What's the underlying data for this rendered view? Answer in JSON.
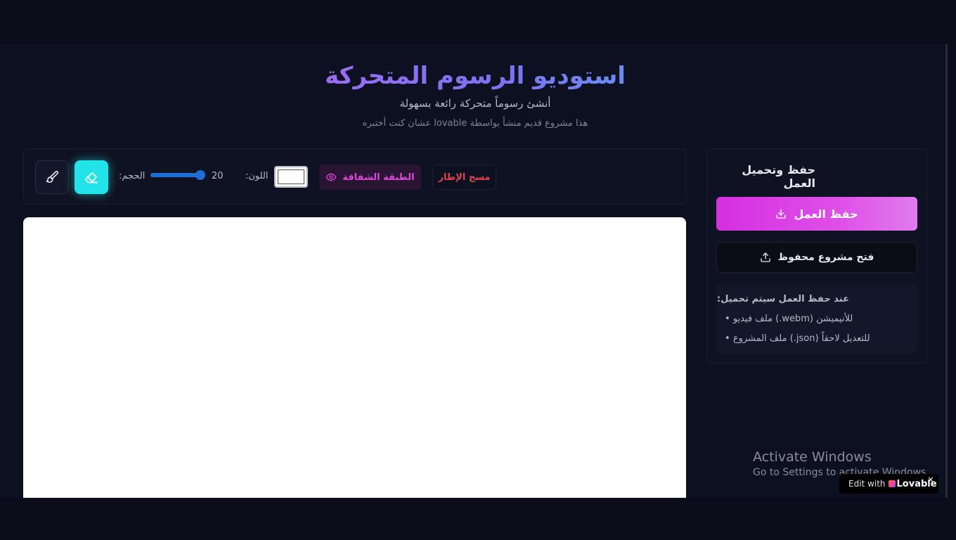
{
  "header": {
    "title": "استوديو الرسوم المتحركة",
    "subtitle": "أنشئ رسوماً متحركة رائعة بسهولة",
    "note": "عشان كنت أختبره lovable هذا مشروع قديم منشأ بواسطة"
  },
  "toolbar": {
    "brush_icon": "paintbrush-icon",
    "eraser_icon": "eraser-icon",
    "size_label": "الحجم:",
    "size_value": "20",
    "color_label": "اللون:",
    "color_value": "#ffffff",
    "onion_label": "الطبقة الشفافة",
    "onion_icon": "eye-icon",
    "clear_label": "مسح الإطار"
  },
  "side_panel": {
    "title": "حفظ وتحميل العمل",
    "save_label": "حفظ العمل",
    "save_icon": "download-icon",
    "open_label": "فتح مشروع محفوظ",
    "open_icon": "upload-icon",
    "info_title": "عند حفظ العمل سيتم تحميل:",
    "info_line1_a": "• ملف فيديو (.webm)",
    "info_line1_b": "للأنيميشن",
    "info_line2_a": "• ملف المشروع (.json)",
    "info_line2_b": "للتعديل لاحقاً"
  },
  "watermark": {
    "title": "Activate Windows",
    "subtitle": "Go to Settings to activate Windows."
  },
  "badge": {
    "prefix": "Edit with",
    "brand": "Lovable",
    "close": "×"
  },
  "colors": {
    "accent": "#d62fe0",
    "eraser_active": "#22e4e8",
    "danger": "#e0454f",
    "background": "#0d1020"
  }
}
